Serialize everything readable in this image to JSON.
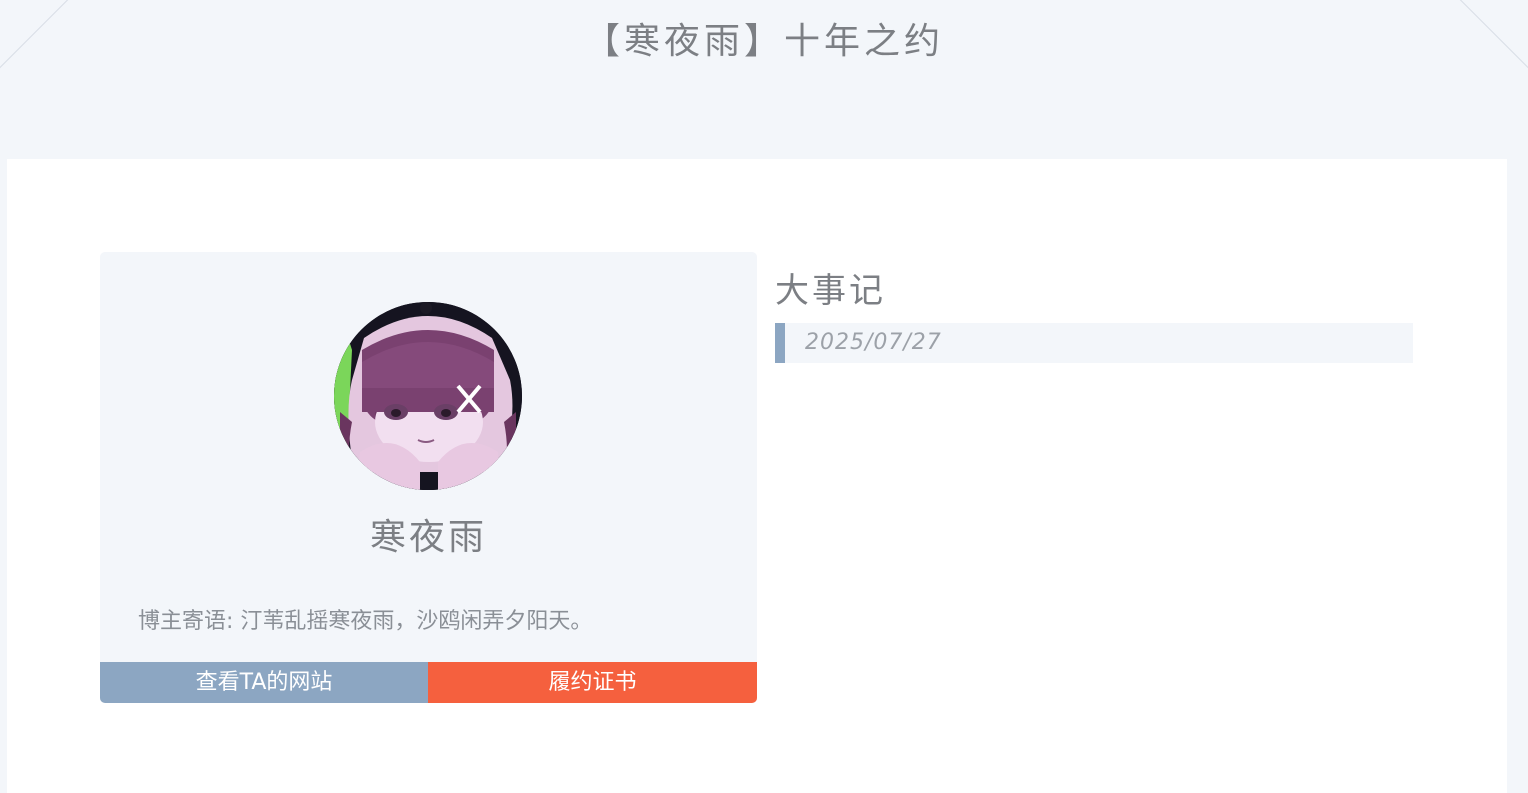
{
  "header": {
    "title": "【寒夜雨】十年之约"
  },
  "profile": {
    "avatar_alt": "avatar",
    "name": "寒夜雨",
    "message": "博主寄语: 汀苇乱摇寒夜雨，沙鸥闲弄夕阳天。",
    "buttons": {
      "site": "查看TA的网站",
      "certificate": "履约证书"
    }
  },
  "events": {
    "title": "大事记",
    "items": [
      {
        "date": "2025/07/27"
      }
    ]
  },
  "colors": {
    "background": "#f3f6fa",
    "accent_blue": "#8ca6c2",
    "accent_orange": "#f5603e",
    "text": "#7c7f84"
  }
}
